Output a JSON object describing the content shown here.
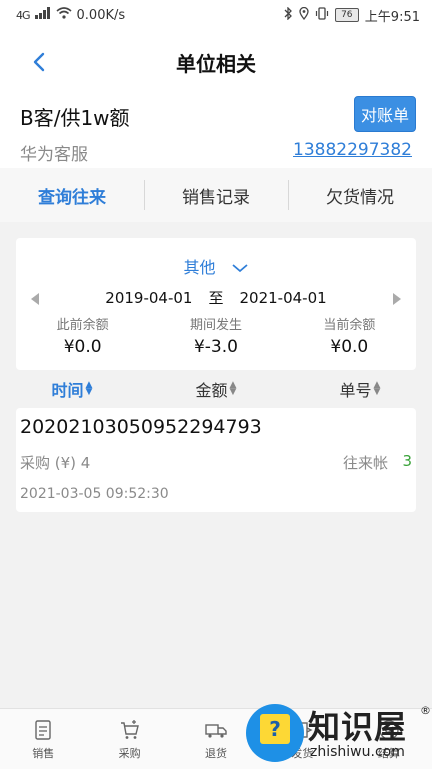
{
  "status_bar": {
    "network_type": "4G",
    "speed": "0.00K/s",
    "battery": "76",
    "time": "上午9:51"
  },
  "nav": {
    "title": "单位相关",
    "back_icon": "chevron-left-icon"
  },
  "customer": {
    "name": "B客/供1w额",
    "contact": "华为客服",
    "phone": "13882297382",
    "statement_button": "对账单"
  },
  "tabs": [
    {
      "label": "查询往来",
      "active": true
    },
    {
      "label": "销售记录",
      "active": false
    },
    {
      "label": "欠货情况",
      "active": false
    }
  ],
  "period": {
    "selector": "其他",
    "start_date": "2019-04-01",
    "to_text": "至",
    "end_date": "2021-04-01"
  },
  "summary": [
    {
      "label": "此前余额",
      "value": "¥0.0"
    },
    {
      "label": "期间发生",
      "value": "¥-3.0"
    },
    {
      "label": "当前余额",
      "value": "¥0.0"
    }
  ],
  "sort_columns": [
    {
      "label": "时间",
      "active": true
    },
    {
      "label": "金额",
      "active": false
    },
    {
      "label": "单号",
      "active": false
    }
  ],
  "records": [
    {
      "number": "20202103050952294793",
      "type_amount": "采购 (¥) 4",
      "category": "往来帐",
      "count": "3",
      "time": "2021-03-05 09:52:30"
    }
  ],
  "bottom_nav": [
    {
      "label": "销售",
      "icon": "sales-doc-icon"
    },
    {
      "label": "采购",
      "icon": "cart-icon"
    },
    {
      "label": "退货",
      "icon": "return-truck-icon"
    },
    {
      "label": "发货",
      "icon": "shipping-icon"
    },
    {
      "label": "结算",
      "icon": "settlement-icon"
    }
  ],
  "watermark": {
    "text": "知识屋",
    "reg": "®",
    "url": "zhishiwu.com"
  },
  "colors": {
    "accent": "#2f7ed8",
    "button": "#3b8fe3",
    "positive": "#3aa33a"
  }
}
